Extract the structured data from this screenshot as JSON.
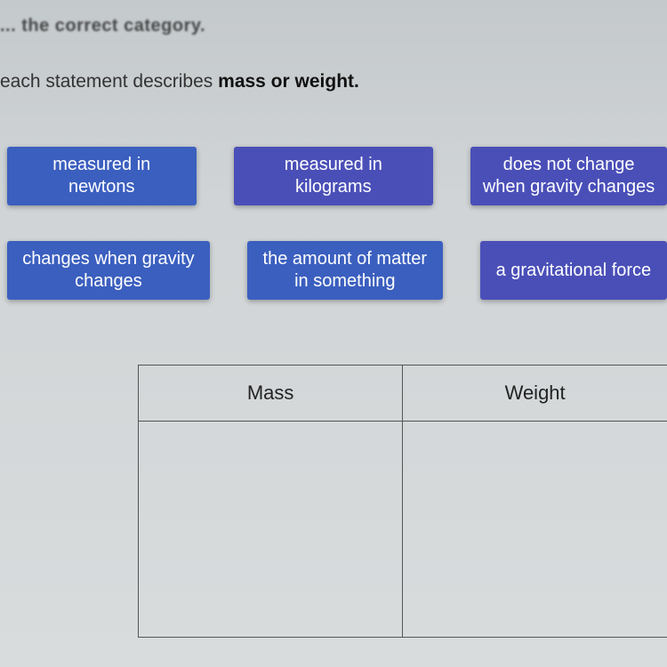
{
  "cutoff_header": "... the correct category.",
  "instruction_prefix": "each statement describes ",
  "instruction_bold": "mass or weight.",
  "tiles": {
    "row1": [
      {
        "label": "measured in newtons",
        "style": "blue"
      },
      {
        "label": "measured in kilograms",
        "style": "purple"
      },
      {
        "label": "does not change when gravity changes",
        "style": "purple"
      }
    ],
    "row2": [
      {
        "label": "changes when gravity changes",
        "style": "blue"
      },
      {
        "label": "the amount of matter in something",
        "style": "blue"
      },
      {
        "label": "a gravitational force",
        "style": "purple"
      }
    ]
  },
  "table": {
    "headers": [
      "Mass",
      "Weight"
    ]
  }
}
